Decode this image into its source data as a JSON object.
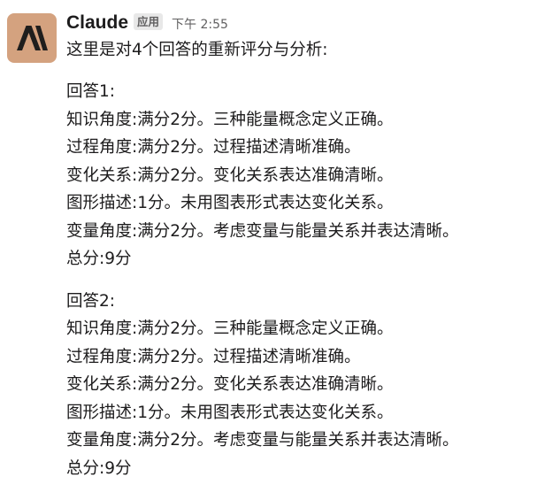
{
  "message": {
    "sender": "Claude",
    "app_badge": "应用",
    "timestamp": "下午 2:55",
    "intro": "这里是对4个回答的重新评分与分析:",
    "answers": [
      {
        "title": "回答1:",
        "lines": [
          "知识角度:满分2分。三种能量概念定义正确。",
          "过程角度:满分2分。过程描述清晰准确。",
          "变化关系:满分2分。变化关系表达准确清晰。",
          "图形描述:1分。未用图表形式表达变化关系。",
          "变量角度:满分2分。考虑变量与能量关系并表达清晰。",
          "总分:9分"
        ]
      },
      {
        "title": "回答2:",
        "lines": [
          "知识角度:满分2分。三种能量概念定义正确。",
          "过程角度:满分2分。过程描述清晰准确。",
          "变化关系:满分2分。变化关系表达准确清晰。",
          "图形描述:1分。未用图表形式表达变化关系。",
          "变量角度:满分2分。考虑变量与能量关系并表达清晰。",
          "总分:9分"
        ]
      }
    ]
  },
  "colors": {
    "avatar_bg": "#d4a27f",
    "avatar_logo": "#1f1e1d",
    "text": "#1d1c1d",
    "muted": "#616061",
    "badge_bg": "#e8e8e8"
  },
  "icons": {
    "avatar": "anthropic-logo-icon"
  }
}
